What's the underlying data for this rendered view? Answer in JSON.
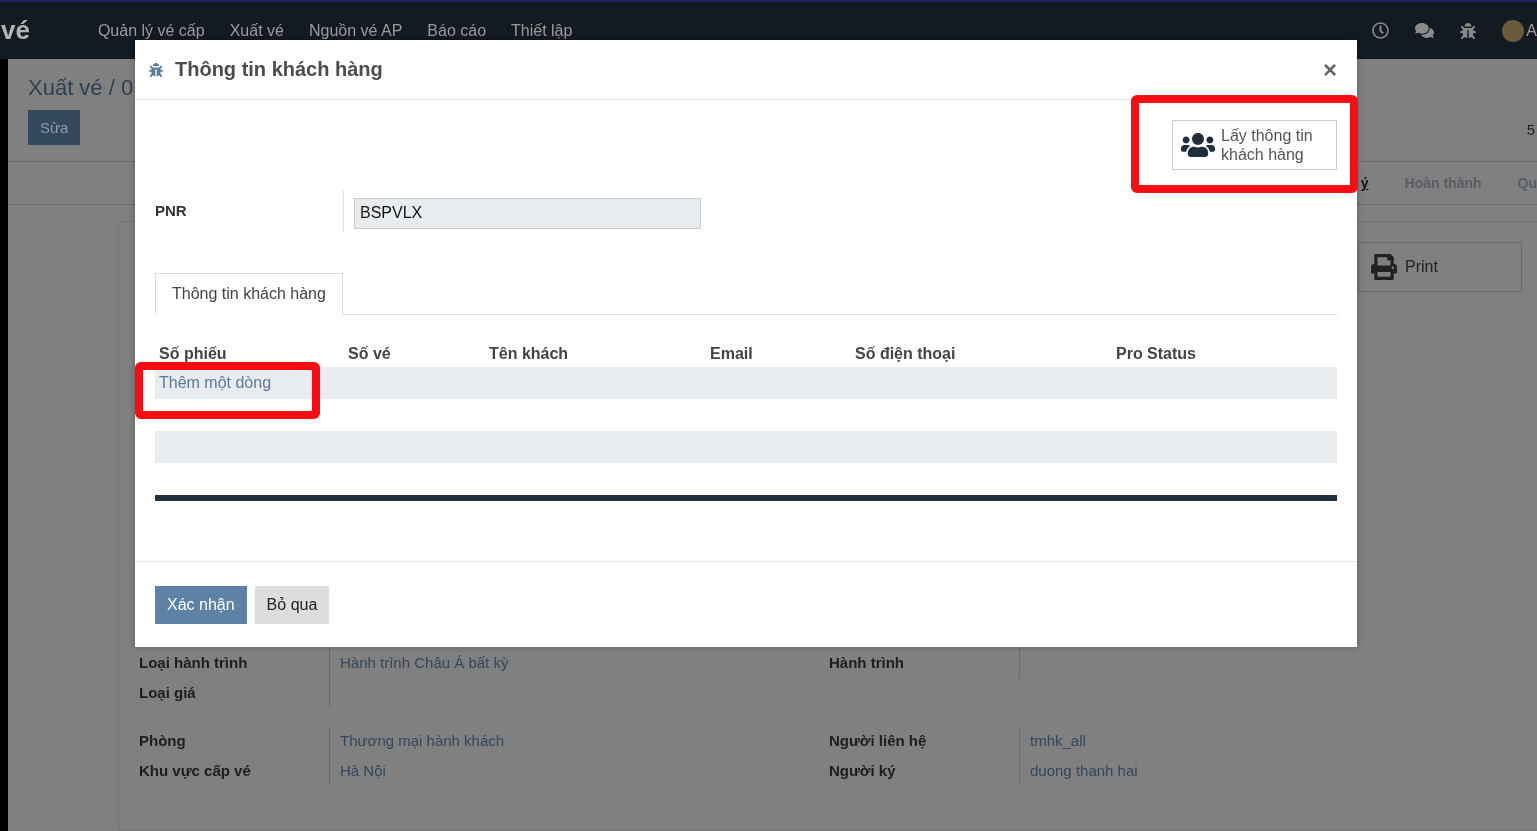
{
  "navbar": {
    "brand": "vé",
    "menu": [
      "Quản lý vé cấp",
      "Xuất vé",
      "Nguồn vé AP",
      "Báo cáo",
      "Thiết lập"
    ],
    "user_initial": "A"
  },
  "background": {
    "breadcrumb": "Xuất vé / 0",
    "edit_button": "Sửa",
    "pager": "5",
    "stages": [
      {
        "label": "ý",
        "selected": true
      },
      {
        "label": "Hoàn thành",
        "selected": false
      },
      {
        "label": "Qu",
        "selected": false
      }
    ],
    "print_button": "Print",
    "field_groups": [
      {
        "rows": [
          {
            "left": {
              "label": "Loại hành trình",
              "value": "Hành trình Châu Á bất kỳ"
            },
            "right": {
              "label": "Hành trình"
            }
          },
          {
            "left": {
              "label": "Loại giá"
            }
          }
        ]
      },
      {
        "rows": [
          {
            "left": {
              "label": "Phòng",
              "value": "Thương mại hành khách"
            },
            "right": {
              "label": "Người liên hệ",
              "value": "tmhk_all"
            }
          },
          {
            "left": {
              "label": "Khu vực cấp vé",
              "value": "Hà Nội"
            },
            "right": {
              "label": "Người ký",
              "value": "duong thanh hai"
            }
          }
        ]
      }
    ]
  },
  "dialog": {
    "title": "Thông tin khách hàng",
    "close": "×",
    "fetch_button": "Lấy thông tin khách hàng",
    "pnr": {
      "label": "PNR",
      "value": "BSPVLX"
    },
    "tabs": [
      {
        "label": "Thông tin khách hàng",
        "selected": true
      }
    ],
    "columns": [
      "Số phiếu",
      "Số vé",
      "Tên khách",
      "Email",
      "Số điện thoại",
      "Pro Status"
    ],
    "add_line": "Thêm một dòng",
    "buttons": [
      {
        "label": "Xác nhận",
        "kind": "primary"
      },
      {
        "label": "Bỏ qua",
        "kind": "secondary"
      }
    ]
  }
}
